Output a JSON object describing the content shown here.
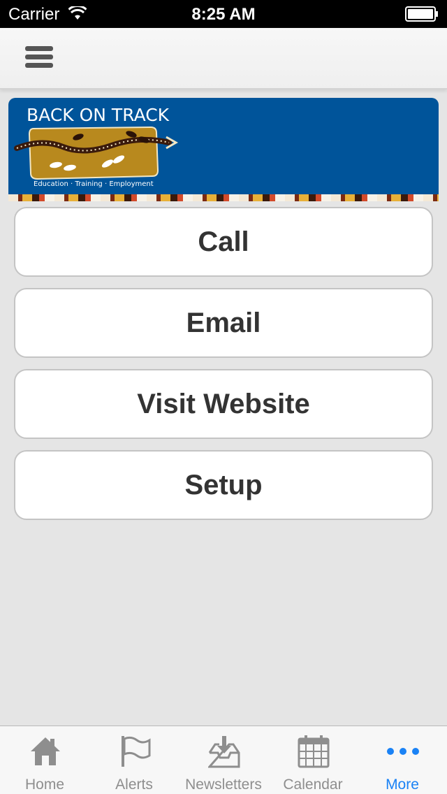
{
  "status_bar": {
    "carrier": "Carrier",
    "time": "8:25 AM",
    "wifi_icon": "wifi-icon",
    "battery_icon": "battery-icon"
  },
  "nav_bar": {
    "menu_icon": "hamburger-menu-icon"
  },
  "banner": {
    "title": "BACK ON TRACK",
    "tagline": "Education · Training · Employment",
    "colors": {
      "background": "#00549a",
      "logo_panel": "#b8891e"
    }
  },
  "actions": [
    {
      "label": "Call"
    },
    {
      "label": "Email"
    },
    {
      "label": "Visit Website"
    },
    {
      "label": "Setup"
    }
  ],
  "tab_bar": {
    "tabs": [
      {
        "label": "Home",
        "icon": "home-icon",
        "active": false
      },
      {
        "label": "Alerts",
        "icon": "flag-icon",
        "active": false
      },
      {
        "label": "Newsletters",
        "icon": "download-tray-icon",
        "active": false
      },
      {
        "label": "Calendar",
        "icon": "calendar-icon",
        "active": false
      },
      {
        "label": "More",
        "icon": "more-dots-icon",
        "active": true
      }
    ],
    "active_color": "#1a82f5",
    "inactive_color": "#8e8e8e"
  }
}
